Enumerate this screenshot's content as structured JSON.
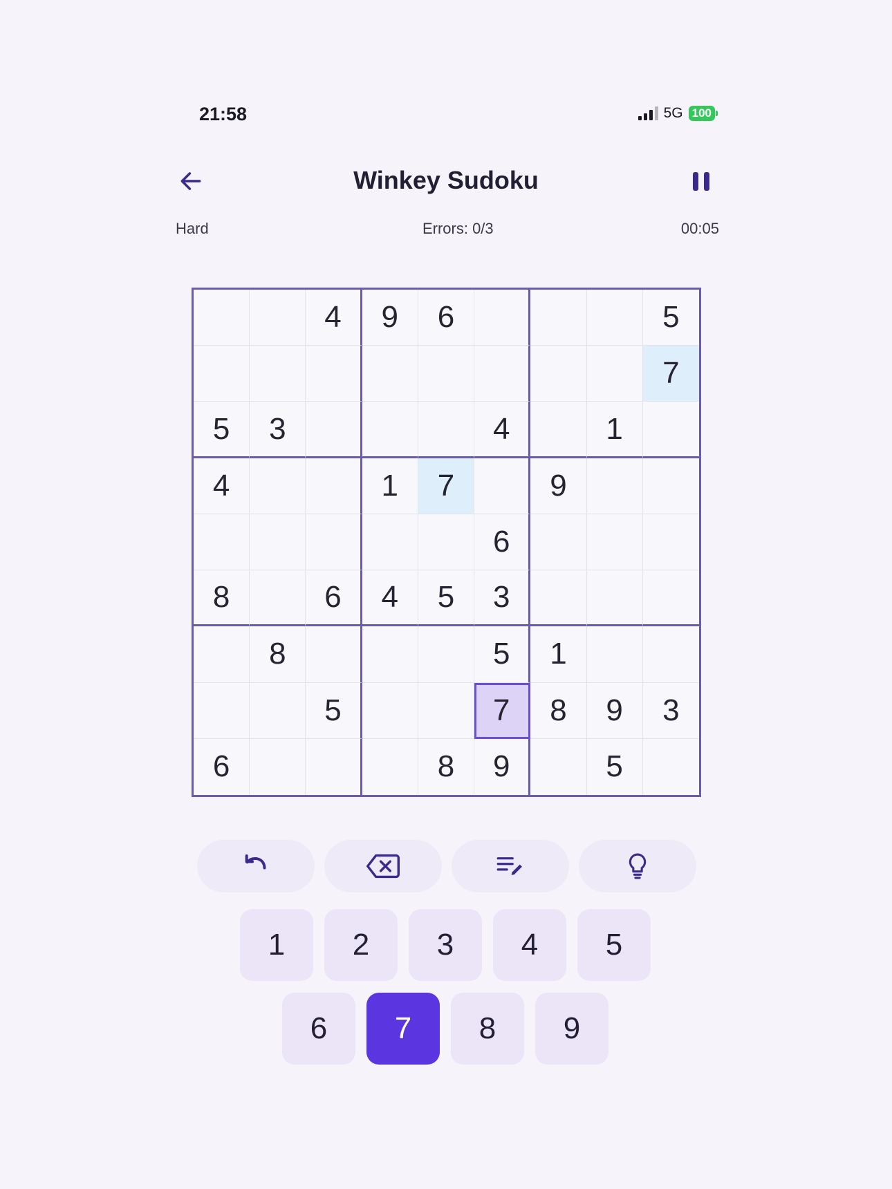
{
  "status_bar": {
    "time": "21:58",
    "network": "5G",
    "battery": "100"
  },
  "header": {
    "title": "Winkey Sudoku",
    "back_icon": "arrow-left-icon",
    "pause_icon": "pause-icon"
  },
  "info": {
    "difficulty": "Hard",
    "errors": "Errors: 0/3",
    "timer": "00:05"
  },
  "board": {
    "grid": [
      [
        "",
        "",
        "4",
        "9",
        "6",
        "",
        "",
        "",
        "5"
      ],
      [
        "",
        "",
        "",
        "",
        "",
        "",
        "",
        "",
        "7"
      ],
      [
        "5",
        "3",
        "",
        "",
        "",
        "4",
        "",
        "1",
        ""
      ],
      [
        "4",
        "",
        "",
        "1",
        "7",
        "",
        "9",
        "",
        ""
      ],
      [
        "",
        "",
        "",
        "",
        "",
        "6",
        "",
        "",
        ""
      ],
      [
        "8",
        "",
        "6",
        "4",
        "5",
        "3",
        "",
        "",
        ""
      ],
      [
        "",
        "8",
        "",
        "",
        "",
        "5",
        "1",
        "",
        ""
      ],
      [
        "",
        "",
        "5",
        "",
        "",
        "7",
        "8",
        "9",
        "3"
      ],
      [
        "6",
        "",
        "",
        "",
        "8",
        "9",
        "",
        "5",
        ""
      ]
    ],
    "selected_cell": [
      7,
      5
    ],
    "highlighted_cells": [
      [
        1,
        8
      ],
      [
        3,
        4
      ]
    ],
    "colors": {
      "grid_line": "#6a5ca8",
      "highlight": "#dfeefb",
      "selected": "#ddd3f7",
      "selected_border": "#6b4fd0"
    }
  },
  "tools": [
    {
      "name": "undo-button",
      "icon": "undo-icon"
    },
    {
      "name": "erase-button",
      "icon": "backspace-icon"
    },
    {
      "name": "notes-button",
      "icon": "pencil-notes-icon"
    },
    {
      "name": "hint-button",
      "icon": "lightbulb-icon"
    }
  ],
  "numpad": {
    "row1": [
      "1",
      "2",
      "3",
      "4",
      "5"
    ],
    "row2": [
      "6",
      "7",
      "8",
      "9"
    ],
    "active": "7",
    "active_color": "#5b35e0"
  }
}
